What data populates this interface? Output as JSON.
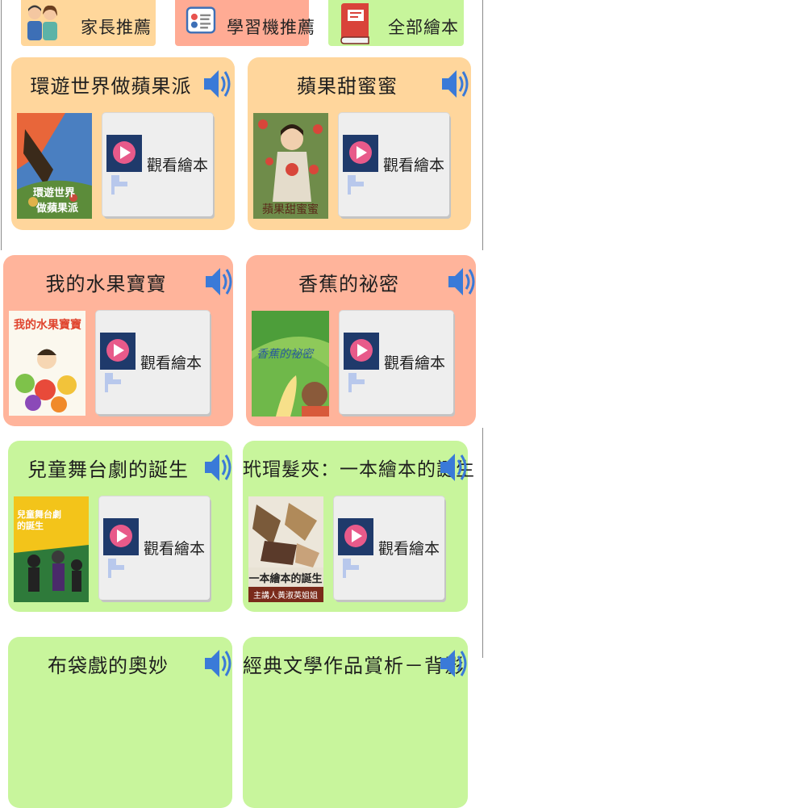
{
  "tabs": [
    {
      "label": "家長推薦",
      "icon": "parents-icon"
    },
    {
      "label": "學習機推薦",
      "icon": "learning-machine-icon"
    },
    {
      "label": "全部繪本",
      "icon": "book-icon"
    }
  ],
  "view_label": "觀看繪本",
  "colors": {
    "orange": "#ffd69c",
    "salmon": "#ffb49b",
    "green": "#c8f59c",
    "play": "#1f3a6b",
    "play_accent": "#e85a8a"
  },
  "books": [
    {
      "title": "環遊世界做蘋果派",
      "cover_text": "環遊世界\n做蘋果派",
      "theme": "orange"
    },
    {
      "title": "蘋果甜蜜蜜",
      "cover_text": "蘋果甜蜜蜜",
      "theme": "orange"
    },
    {
      "title": "我的水果寶寶",
      "cover_text": "我的水果寶寶",
      "theme": "salmon"
    },
    {
      "title": "香蕉的祕密",
      "cover_text": "香蕉的祕密",
      "theme": "salmon"
    },
    {
      "title": "兒童舞台劇的誕生",
      "cover_text": "兒童舞台劇的誕生",
      "theme": "green"
    },
    {
      "title": "玳瑁髮夾：一本繪本的誕生",
      "cover_text": "一本繪本的誕生",
      "cover_subtext": "主講人黃淑英姐姐",
      "theme": "green"
    },
    {
      "title": "布袋戲的奧妙",
      "theme": "green"
    },
    {
      "title": "經典文學作品賞析－背影",
      "theme": "green"
    }
  ]
}
